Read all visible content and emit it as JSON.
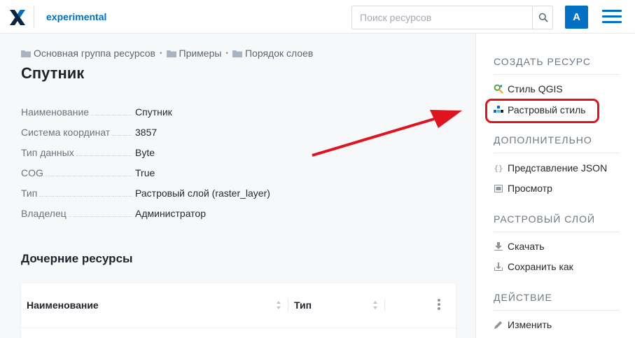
{
  "header": {
    "app_name": "experimental",
    "search_placeholder": "Поиск ресурсов",
    "avatar_letter": "A",
    "accent_color": "#0070c5"
  },
  "breadcrumb": [
    {
      "label": "Основная группа ресурсов",
      "icon": "folder-icon"
    },
    {
      "label": "Примеры",
      "icon": "folder-icon"
    },
    {
      "label": "Порядок слоев",
      "icon": "folder-icon"
    }
  ],
  "page": {
    "title": "Спутник"
  },
  "properties": [
    {
      "key": "Наименование",
      "value": "Спутник"
    },
    {
      "key": "Система координат",
      "value": "3857"
    },
    {
      "key": "Тип данных",
      "value": "Byte"
    },
    {
      "key": "COG",
      "value": "True"
    },
    {
      "key": "Тип",
      "value": "Растровый слой (raster_layer)"
    },
    {
      "key": "Владелец",
      "value": "Администратор"
    }
  ],
  "children": {
    "title": "Дочерние ресурсы",
    "columns": [
      "Наименование",
      "Тип"
    ]
  },
  "sidebar": {
    "sections": [
      {
        "title": "СОЗДАТЬ РЕСУРС",
        "items": [
          {
            "label": "Стиль QGIS",
            "icon": "qgis-icon"
          },
          {
            "label": "Растровый стиль",
            "icon": "raster-style-icon",
            "highlighted": true
          }
        ]
      },
      {
        "title": "ДОПОЛНИТЕЛЬНО",
        "items": [
          {
            "label": "Представление JSON",
            "icon": "json-icon"
          },
          {
            "label": "Просмотр",
            "icon": "preview-icon"
          }
        ]
      },
      {
        "title": "РАСТРОВЫЙ СЛОЙ",
        "items": [
          {
            "label": "Скачать",
            "icon": "download-icon"
          },
          {
            "label": "Сохранить как",
            "icon": "save-as-icon"
          }
        ]
      },
      {
        "title": "ДЕЙСТВИЕ",
        "items": [
          {
            "label": "Изменить",
            "icon": "edit-icon"
          }
        ]
      }
    ]
  },
  "annotation": {
    "highlight_color": "#e0141e"
  }
}
